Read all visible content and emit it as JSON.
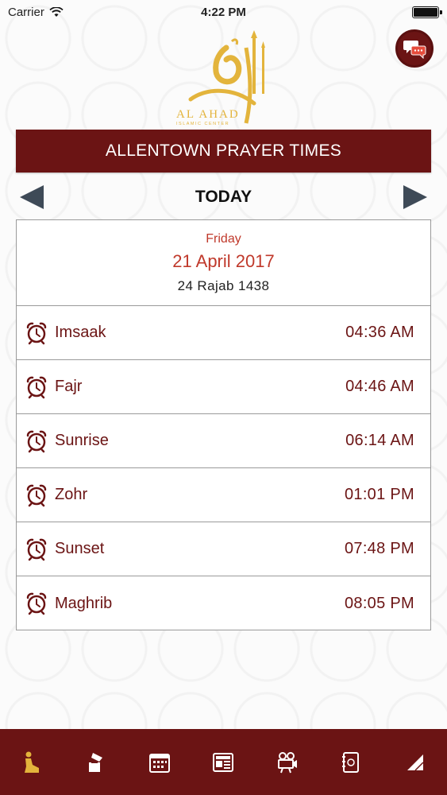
{
  "status_bar": {
    "carrier": "Carrier",
    "time": "4:22 PM"
  },
  "logo": {
    "line1": "AL AHAD",
    "line2": "ISLAMIC CENTER"
  },
  "header": {
    "title": "ALLENTOWN PRAYER TIMES"
  },
  "nav": {
    "label": "TODAY"
  },
  "date": {
    "weekday": "Friday",
    "gregorian": "21 April 2017",
    "hijri": "24 Rajab 1438"
  },
  "prayers": [
    {
      "name": "Imsaak",
      "time": "04:36 AM"
    },
    {
      "name": "Fajr",
      "time": "04:46 AM"
    },
    {
      "name": "Sunrise",
      "time": "06:14 AM"
    },
    {
      "name": "Zohr",
      "time": "01:01 PM"
    },
    {
      "name": "Sunset",
      "time": "07:48 PM"
    },
    {
      "name": "Maghrib",
      "time": "08:05 PM"
    }
  ],
  "colors": {
    "primary": "#6b1414",
    "accent": "#c0392b",
    "gold": "#e3b43c"
  },
  "tabs": [
    {
      "icon": "prayer-person-icon",
      "active": true
    },
    {
      "icon": "donate-icon"
    },
    {
      "icon": "calendar-icon"
    },
    {
      "icon": "news-icon"
    },
    {
      "icon": "video-camera-icon"
    },
    {
      "icon": "contact-book-icon"
    },
    {
      "icon": "more-icon"
    }
  ]
}
